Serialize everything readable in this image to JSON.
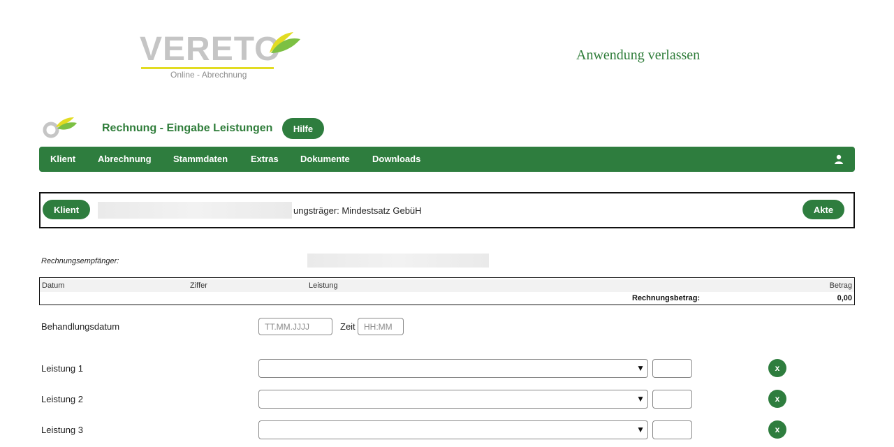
{
  "header": {
    "logo_text": "VERETO",
    "logo_sub": "Online - Abrechnung",
    "exit_link": "Anwendung verlassen"
  },
  "page": {
    "title": "Rechnung - Eingabe Leistungen",
    "help_label": "Hilfe"
  },
  "nav": {
    "items": [
      "Klient",
      "Abrechnung",
      "Stammdaten",
      "Extras",
      "Dokumente",
      "Downloads"
    ]
  },
  "client_bar": {
    "client_label": "Klient",
    "info_text": "ungsträger: Mindestsatz GebüH",
    "file_label": "Akte"
  },
  "recipient": {
    "label": "Rechnungsempfänger:"
  },
  "table": {
    "headers": [
      "Datum",
      "Ziffer",
      "Leistung",
      "Betrag"
    ],
    "total_label": "Rechnungsbetrag:",
    "total_value": "0,00"
  },
  "treatment": {
    "label": "Behandlungsdatum",
    "date_placeholder": "TT.MM.JJJJ",
    "time_label": "Zeit",
    "time_placeholder": "HH:MM"
  },
  "services": [
    {
      "label": "Leistung 1",
      "remove": "x"
    },
    {
      "label": "Leistung 2",
      "remove": "x"
    },
    {
      "label": "Leistung 3",
      "remove": "x"
    }
  ],
  "select_caret": "▼",
  "colors": {
    "brand_green": "#2e7d3e",
    "logo_yellow": "#e2dc22",
    "logo_gray": "#c5c5c5"
  },
  "icons": [
    "leaf-icon",
    "user-icon",
    "chevron-down-icon"
  ]
}
